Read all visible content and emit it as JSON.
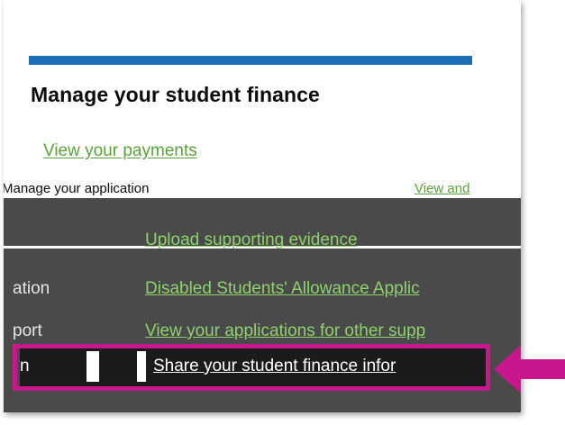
{
  "heading": "Manage your student finance",
  "links": {
    "view_payments": "View your payments",
    "upload_evidence": "Upload supporting evidence",
    "disabled_students": "Disabled Students' Allowance Applic",
    "view_other_applications": "View your applications for other supp",
    "share_info": "Share your student finance infor"
  },
  "row_manage": {
    "left": "Manage your application",
    "right": "View and"
  },
  "fragments": {
    "ation": "ation",
    "port": "port"
  },
  "colors": {
    "accent_blue": "#1d70b8",
    "link_green": "#5aa33c",
    "highlight_magenta": "#c8168c",
    "dark_panel": "#4a4a4a"
  },
  "icons": {
    "pointer": "arrow-left-icon"
  }
}
